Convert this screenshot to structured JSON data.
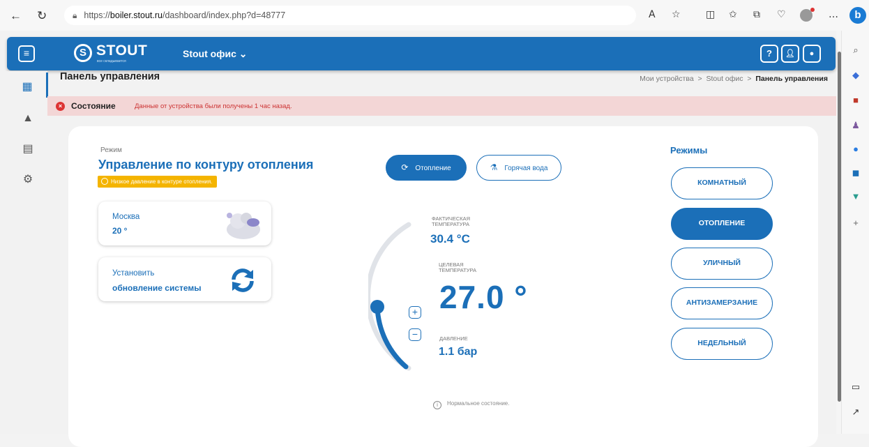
{
  "browser": {
    "url_prefix": "https://",
    "url_host": "boiler.stout.ru",
    "url_path": "/dashboard/index.php?d=48777"
  },
  "header": {
    "logo": "STOUT",
    "logo_tagline": "все складывается",
    "office_label": "Stout офис",
    "help_label": "?"
  },
  "page": {
    "title": "Панель управления",
    "breadcrumb": [
      "Мои устройства",
      "Stout офис",
      "Панель управления"
    ]
  },
  "alert": {
    "title": "Состояние",
    "message": "Данные от устройства были получены 1 час назад."
  },
  "mode": {
    "label": "Режим",
    "title": "Управление по контуру отопления",
    "warning": "Низкое давление в контуре отопления."
  },
  "weather": {
    "city": "Москва",
    "temp": "20 °"
  },
  "update": {
    "line1": "Установить",
    "line2": "обновление системы"
  },
  "tabs": {
    "heating": "Отопление",
    "hot_water": "Горячая вода"
  },
  "readings": {
    "actual_label_1": "ФАКТИЧЕСКАЯ",
    "actual_label_2": "ТЕМПЕРАТУРА",
    "actual_value": "30.4 °C",
    "target_label_1": "ЦЕЛЕВАЯ",
    "target_label_2": "ТЕМПЕРАТУРА",
    "target_value": "27.0 °",
    "pressure_label": "ДАВЛЕНИЕ",
    "pressure_value": "1.1 бар",
    "status": "Нормальное состояние."
  },
  "modes": {
    "title": "Режимы",
    "items": [
      "КОМНАТНЫЙ",
      "ОТОПЛЕНИЕ",
      "УЛИЧНЫЙ",
      "АНТИЗАМЕРЗАНИЕ",
      "НЕДЕЛЬНЫЙ"
    ],
    "active": "ОТОПЛЕНИЕ"
  },
  "colors": {
    "brand": "#1b6fb8",
    "alert_bg": "#f3d6d6",
    "warning": "#f4b400"
  }
}
